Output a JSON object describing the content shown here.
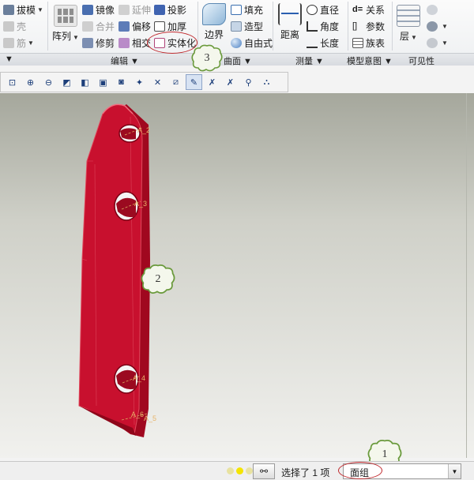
{
  "ribbon": {
    "col1": [
      "拔模",
      "壳",
      "筋"
    ],
    "array": "阵列",
    "col2": [
      "镜像",
      "合并",
      "修剪"
    ],
    "col3": [
      "延伸",
      "偏移",
      "相交"
    ],
    "col4": [
      "投影",
      "加厚",
      "实体化"
    ],
    "boundary": "边界",
    "col5": [
      "填充",
      "造型",
      "自由式"
    ],
    "distance": "距离",
    "col6": [
      "直径",
      "角度",
      "长度"
    ],
    "col7": [
      "关系",
      "参数",
      "族表"
    ],
    "layer": "层",
    "groups": {
      "edit": "编辑",
      "surface": "曲面",
      "measure": "测量",
      "model_intent": "模型意图",
      "visibility": "可见性"
    }
  },
  "toolbar_icons": [
    "refit-icon",
    "zoom-in-icon",
    "zoom-out-icon",
    "repaint-icon",
    "display-style-icon",
    "saved-orientation-icon",
    "view-manager-icon",
    "datum-display-icon",
    "plane-display-icon",
    "axis-display-icon",
    "point-display-icon",
    "csys-display-icon",
    "annotation-display-icon",
    "spin-center-icon"
  ],
  "model": {
    "labels": [
      "A_2",
      "A_3",
      "A_4",
      "A_6",
      "A_5"
    ]
  },
  "callouts": [
    "1",
    "2",
    "3"
  ],
  "status": {
    "selected_text": "选择了 1 项",
    "filter_value": "面组"
  },
  "colors": {
    "model_red": "#c8102e",
    "highlight_ellipse": "#c0282c",
    "callout_fill": "#f4f7ec",
    "callout_stroke": "#6a9a3c"
  }
}
